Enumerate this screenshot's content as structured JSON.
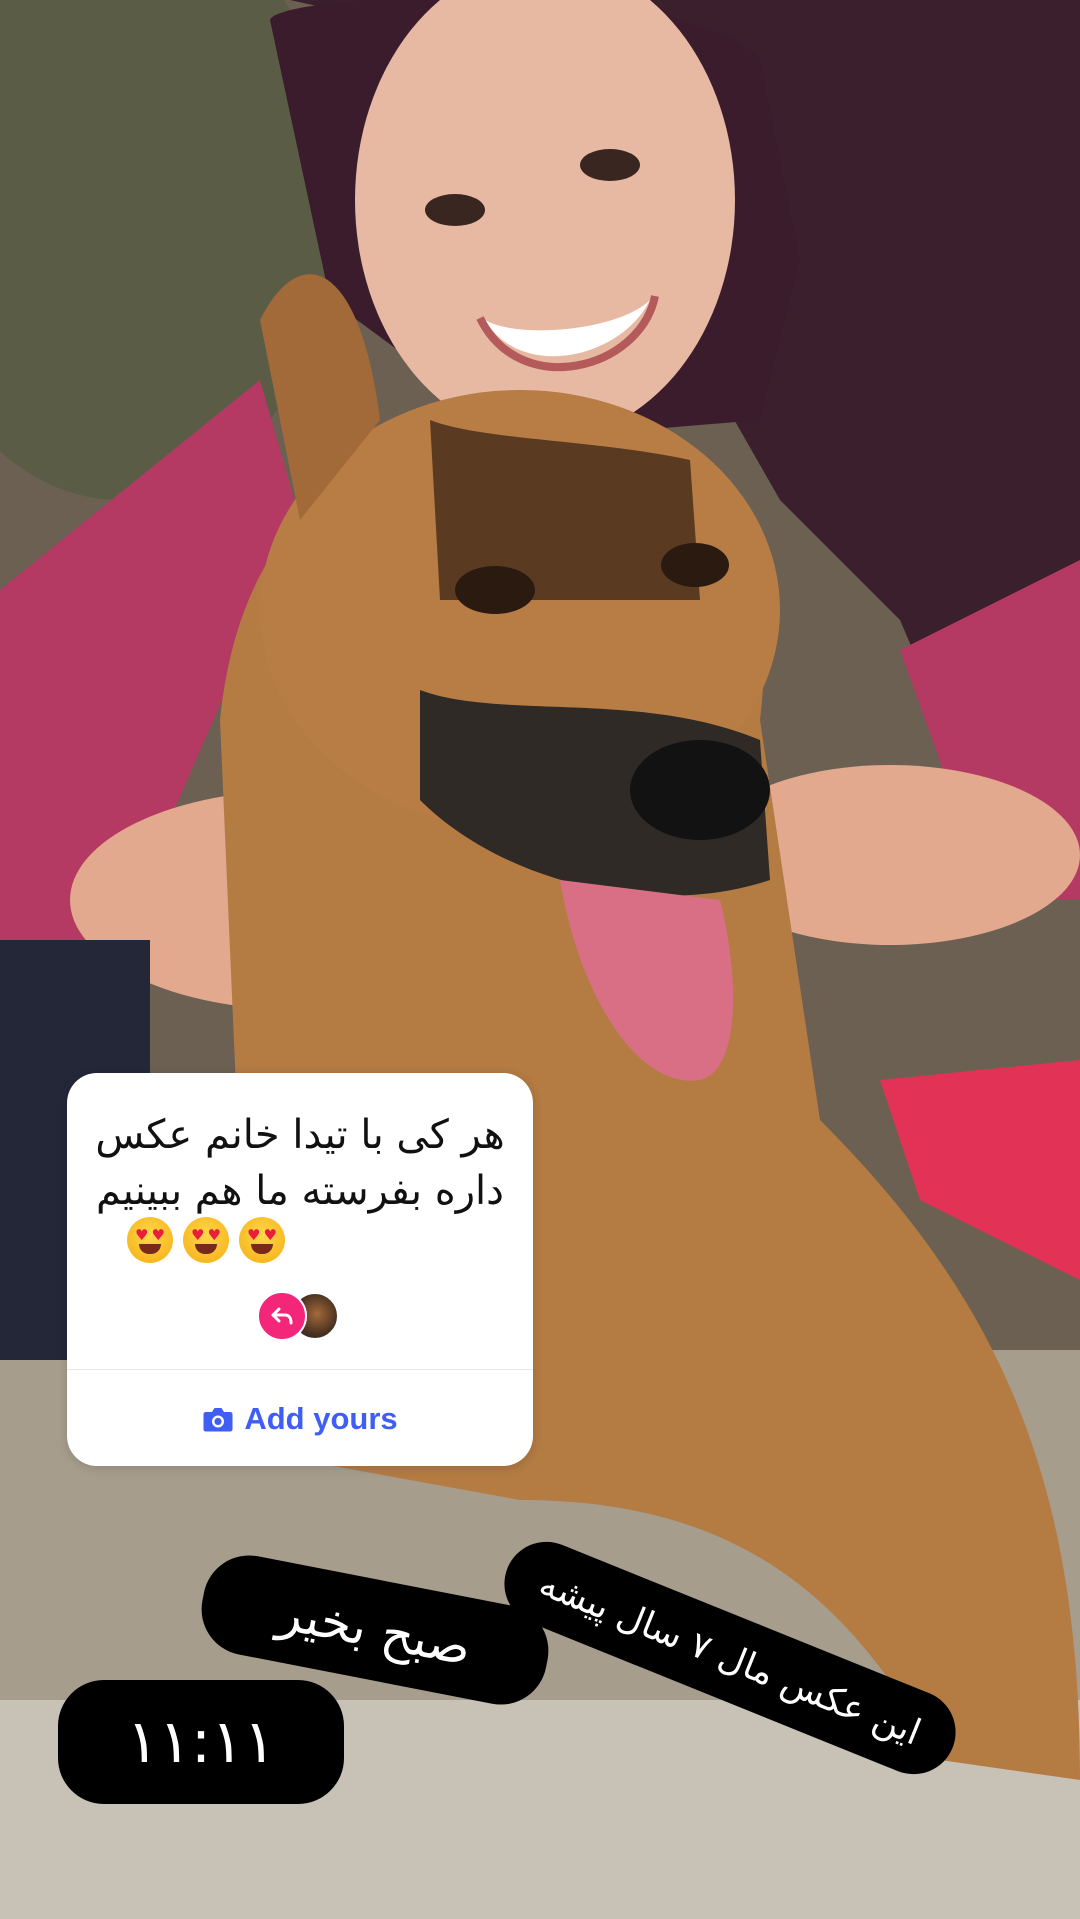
{
  "story": {
    "background_description_icon": "photo-woman-with-dog"
  },
  "add_yours_sticker": {
    "prompt": "هر کی با تیدا خانم عکس داره بفرسته ما هم ببینیم",
    "button_label": "Add yours",
    "button_icon": "camera-icon",
    "emoji_icon": "heart-eyes-emoji",
    "emoji_count": 3
  },
  "text_stickers": {
    "time": "۱۱:۱۱",
    "greeting": "صبح بخیر",
    "note": "این عکس مال ۷ سال پیشه"
  },
  "colors": {
    "accent_blue": "#3f5ef5",
    "reply_pink": "#f4267a",
    "sticker_bg": "#ffffff",
    "pill_bg": "#000000"
  }
}
